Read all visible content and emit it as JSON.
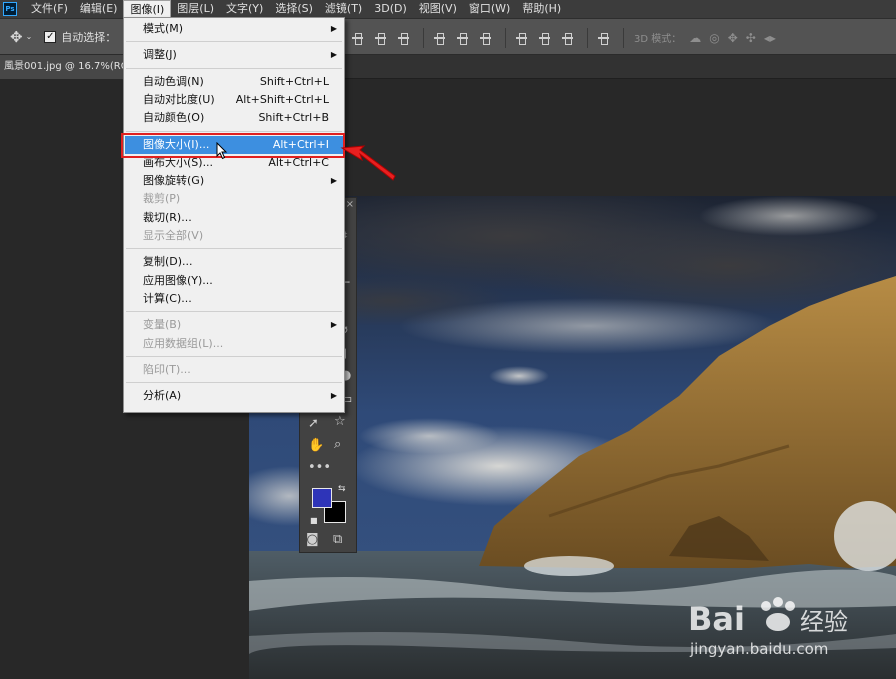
{
  "menubar": {
    "logo": "Ps",
    "items": [
      "文件(F)",
      "编辑(E)",
      "图像(I)",
      "图层(L)",
      "文字(Y)",
      "选择(S)",
      "滤镜(T)",
      "3D(D)",
      "视图(V)",
      "窗口(W)",
      "帮助(H)"
    ],
    "active_index": 2
  },
  "options_bar": {
    "autoselect_label": "自动选择：",
    "autoselect_checked": true,
    "mode3d_label": "3D 模式："
  },
  "document": {
    "tab_title": "風景001.jpg @ 16.7%(RG"
  },
  "image_menu": {
    "items": [
      {
        "label": "模式(M)",
        "shortcut": "",
        "submenu": true,
        "disabled": false
      },
      {
        "sep": true
      },
      {
        "label": "调整(J)",
        "shortcut": "",
        "submenu": true,
        "disabled": false
      },
      {
        "sep": true
      },
      {
        "label": "自动色调(N)",
        "shortcut": "Shift+Ctrl+L",
        "submenu": false,
        "disabled": false
      },
      {
        "label": "自动对比度(U)",
        "shortcut": "Alt+Shift+Ctrl+L",
        "submenu": false,
        "disabled": false
      },
      {
        "label": "自动颜色(O)",
        "shortcut": "Shift+Ctrl+B",
        "submenu": false,
        "disabled": false
      },
      {
        "sep": true
      },
      {
        "label": "图像大小(I)...",
        "shortcut": "Alt+Ctrl+I",
        "submenu": false,
        "disabled": false,
        "highlight": true
      },
      {
        "label": "画布大小(S)...",
        "shortcut": "Alt+Ctrl+C",
        "submenu": false,
        "disabled": false
      },
      {
        "label": "图像旋转(G)",
        "shortcut": "",
        "submenu": true,
        "disabled": false
      },
      {
        "label": "裁剪(P)",
        "shortcut": "",
        "submenu": false,
        "disabled": true
      },
      {
        "label": "裁切(R)...",
        "shortcut": "",
        "submenu": false,
        "disabled": false
      },
      {
        "label": "显示全部(V)",
        "shortcut": "",
        "submenu": false,
        "disabled": true
      },
      {
        "sep": true
      },
      {
        "label": "复制(D)...",
        "shortcut": "",
        "submenu": false,
        "disabled": false
      },
      {
        "label": "应用图像(Y)...",
        "shortcut": "",
        "submenu": false,
        "disabled": false
      },
      {
        "label": "计算(C)...",
        "shortcut": "",
        "submenu": false,
        "disabled": false
      },
      {
        "sep": true
      },
      {
        "label": "变量(B)",
        "shortcut": "",
        "submenu": true,
        "disabled": true
      },
      {
        "label": "应用数据组(L)...",
        "shortcut": "",
        "submenu": false,
        "disabled": true
      },
      {
        "sep": true
      },
      {
        "label": "陷印(T)...",
        "shortcut": "",
        "submenu": false,
        "disabled": true
      },
      {
        "sep": true
      },
      {
        "label": "分析(A)",
        "shortcut": "",
        "submenu": true,
        "disabled": false
      }
    ]
  },
  "toolbox": {
    "foreground_color": "#2e34b8",
    "background_color": "#000000"
  },
  "watermark": {
    "brand": "Bai",
    "brand_cn": "经验",
    "url": "jingyan.baidu.com"
  },
  "colors": {
    "menu_highlight": "#3d8fe0",
    "annotation_red": "#e02020"
  }
}
